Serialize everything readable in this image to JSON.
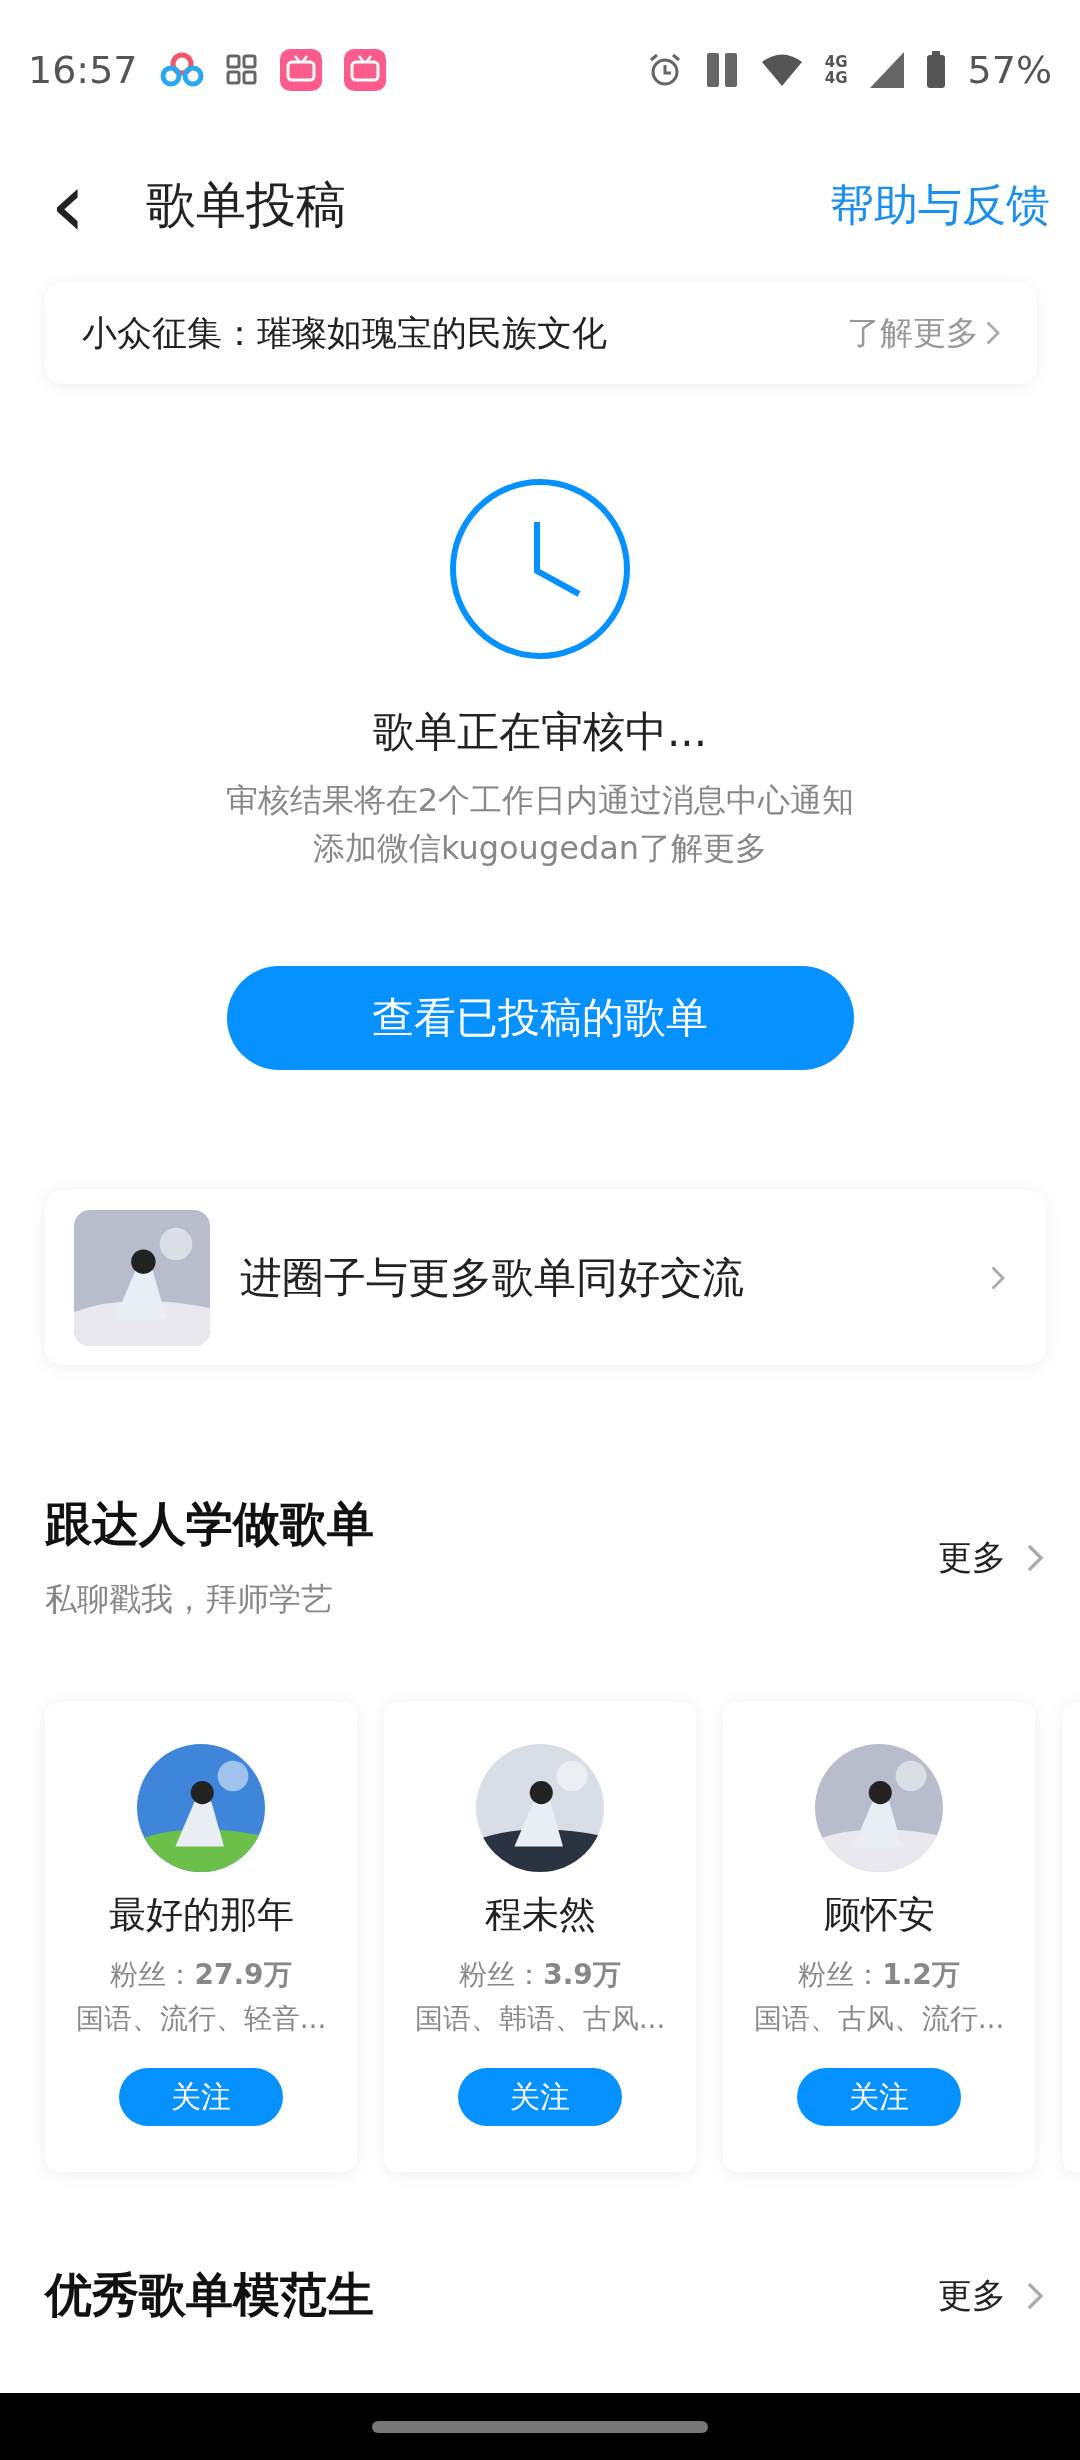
{
  "status_bar": {
    "time": "16:57",
    "network_labels": [
      "4G",
      "4G"
    ],
    "battery": "57%"
  },
  "header": {
    "back": "‹",
    "title": "歌单投稿",
    "action": "帮助与反馈"
  },
  "banner": {
    "text": "小众征集：璀璨如瑰宝的民族文化",
    "link": "了解更多"
  },
  "review": {
    "title": "歌单正在审核中...",
    "lines": [
      "审核结果将在2个工作日内通过消息中心通知",
      "添加微信kugougedan了解更多"
    ],
    "button": "查看已投稿的歌单"
  },
  "community": {
    "text": "进圈子与更多歌单同好交流"
  },
  "sections": [
    {
      "title": "跟达人学做歌单",
      "subtitle": "私聊戳我，拜师学艺",
      "more": "更多",
      "creators": [
        {
          "name": "最好的那年",
          "fans": "粉丝：**27.9万**",
          "tags": "国语、流行、轻音...",
          "follow": "关注"
        },
        {
          "name": "程未然",
          "fans": "粉丝：**3.9万**",
          "tags": "国语、韩语、古风...",
          "follow": "关注"
        },
        {
          "name": "顾怀安",
          "fans": "粉丝：**1.2万**",
          "tags": "国语、古风、流行...",
          "follow": "关注"
        }
      ]
    },
    {
      "title": "优秀歌单模范生",
      "more": "更多"
    }
  ]
}
